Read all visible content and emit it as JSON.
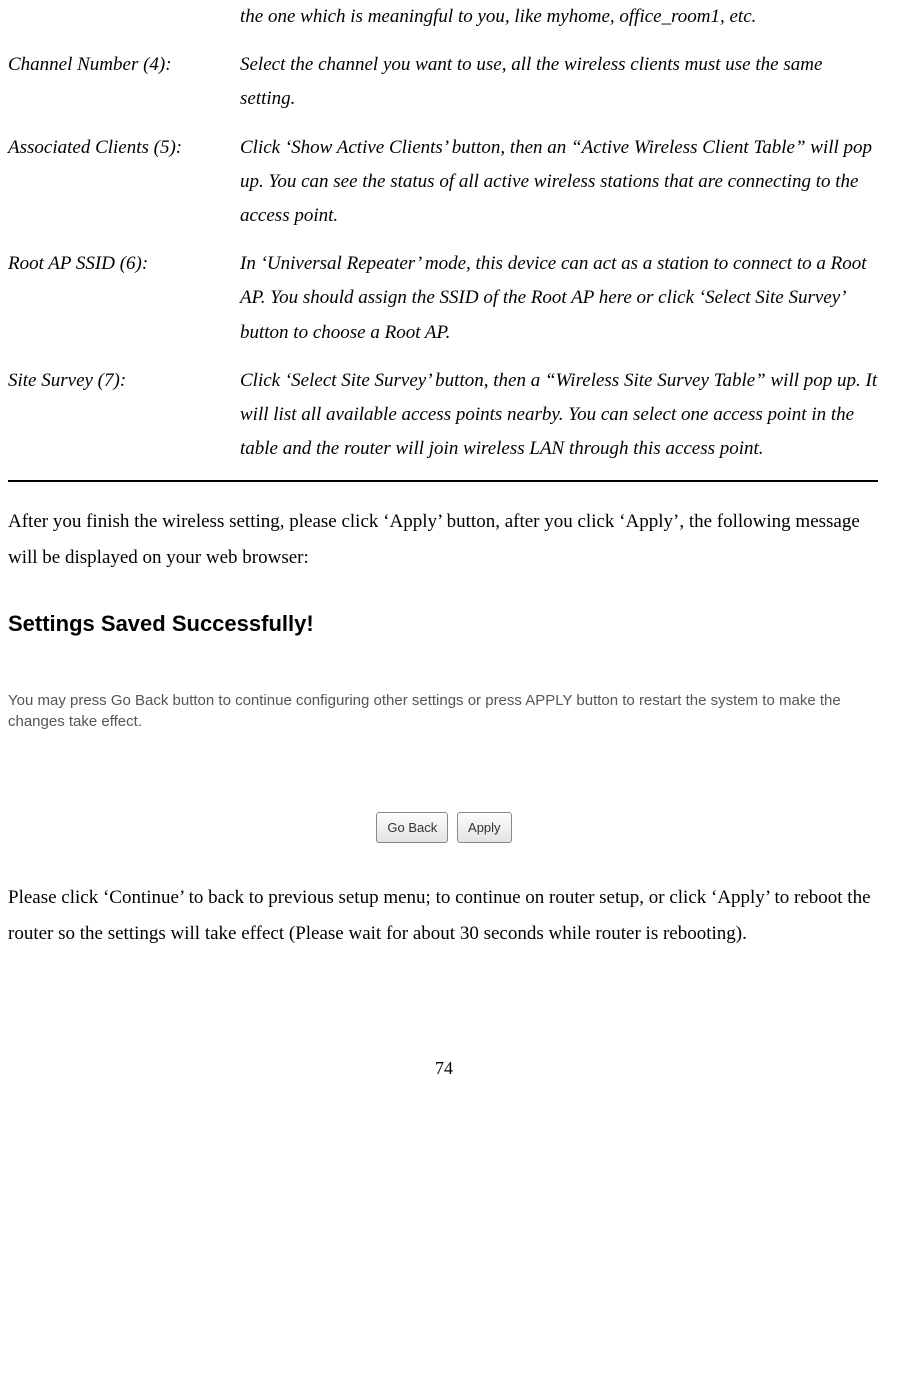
{
  "defs": {
    "ssid_cont": "the one which is meaningful to you, like myhome, office_room1, etc.",
    "channel_label": "Channel Number (4):",
    "channel_desc": "Select the channel you want to use, all the wireless clients must use the same setting.",
    "assoc_label": "Associated Clients (5):",
    "assoc_desc": "Click ‘Show Active Clients’ button, then an “Active Wireless Client Table” will pop up. You can see the status of all active wireless stations that are connecting to the access point.",
    "rootap_label": "Root AP SSID (6):",
    "rootap_desc": "In ‘Universal Repeater’ mode, this device can act as a station to connect to a Root AP. You should assign the SSID of the Root AP here or click ‘Select Site Survey’ button to choose a Root AP.",
    "survey_label": "Site Survey (7):",
    "survey_desc": "Click ‘Select Site Survey’ button, then a “Wireless Site Survey Table” will pop up. It will list all available access points nearby. You can select one access point in the table and the router will join wireless LAN through this access point."
  },
  "body": {
    "after_apply": "After you finish the wireless setting, please click ‘Apply’ button, after you click ‘Apply’, the following message will be displayed on your web browser:",
    "please_continue": "Please click ‘Continue’ to back to previous setup menu; to continue on router setup, or click ‘Apply’ to reboot the router so the settings will take effect (Please wait for about 30 seconds while router is rebooting)."
  },
  "dialog": {
    "heading": "Settings Saved Successfully!",
    "subtext": "You may press Go Back button to continue configuring other settings or press APPLY button to restart the system to make the changes take effect.",
    "go_back": "Go Back",
    "apply": "Apply"
  },
  "page_number": "74"
}
